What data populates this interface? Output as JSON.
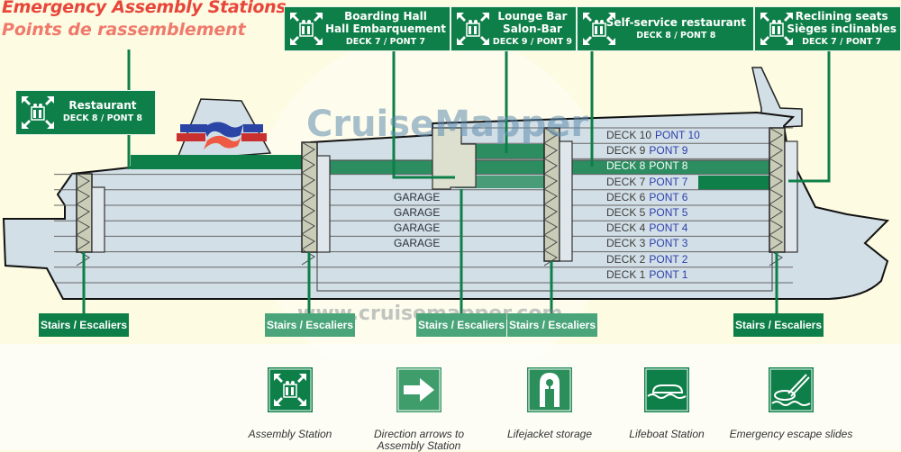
{
  "title": {
    "en": "Emergency Assembly Stations",
    "fr": "Points de rassemblement"
  },
  "colors": {
    "sign_green": "#0e7f48",
    "title_red": "#e8463a",
    "hull": "#d2dfe6",
    "background": "#fdfbe2"
  },
  "assembly_stations": [
    {
      "name": "Restaurant",
      "name_fr": "",
      "deck": "DECK 8 / PONT 8",
      "icon": "assembly-station-icon"
    },
    {
      "name": "Boarding Hall",
      "name_fr": "Hall Embarquement",
      "deck": "DECK 7 / PONT 7",
      "icon": "assembly-station-icon"
    },
    {
      "name": "Lounge Bar",
      "name_fr": "Salon-Bar",
      "deck": "DECK 9 / PONT 9",
      "icon": "assembly-station-icon"
    },
    {
      "name": "Self-service restaurant",
      "name_fr": "",
      "deck": "DECK 8 / PONT 8",
      "icon": "assembly-station-icon"
    },
    {
      "name": "Reclining seats",
      "name_fr": "Sièges inclinables",
      "deck": "DECK 7 / PONT 7",
      "icon": "assembly-station-icon"
    }
  ],
  "decks": [
    {
      "deck": "DECK 10",
      "pont": "PONT 10",
      "highlighted": false
    },
    {
      "deck": "DECK 9",
      "pont": "PONT 9",
      "highlighted": false
    },
    {
      "deck": "DECK 8",
      "pont": "PONT 8",
      "highlighted": true
    },
    {
      "deck": "DECK 7",
      "pont": "PONT 7",
      "highlighted": false
    },
    {
      "deck": "DECK 6",
      "pont": "PONT 6",
      "highlighted": false
    },
    {
      "deck": "DECK 5",
      "pont": "PONT 5",
      "highlighted": false
    },
    {
      "deck": "DECK 4",
      "pont": "PONT 4",
      "highlighted": false
    },
    {
      "deck": "DECK 3",
      "pont": "PONT 3",
      "highlighted": false
    },
    {
      "deck": "DECK 2",
      "pont": "PONT 2",
      "highlighted": false
    },
    {
      "deck": "DECK 1",
      "pont": "PONT 1",
      "highlighted": false
    }
  ],
  "garages": [
    "GARAGE",
    "GARAGE",
    "GARAGE",
    "GARAGE"
  ],
  "stairs": [
    {
      "label": "Stairs / Escaliers"
    },
    {
      "label": "Stairs / Escaliers"
    },
    {
      "label": "Stairs / Escaliers"
    },
    {
      "label": "Stairs / Escaliers"
    },
    {
      "label": "Stairs / Escaliers"
    }
  ],
  "legend": [
    {
      "label": "Assembly Station",
      "icon": "assembly-station-icon"
    },
    {
      "label": "Direction arrows to Assembly Station",
      "icon": "direction-arrow-icon"
    },
    {
      "label": "Lifejacket storage",
      "icon": "lifejacket-icon"
    },
    {
      "label": "Lifeboat Station",
      "icon": "lifeboat-icon"
    },
    {
      "label": "Emergency escape slides",
      "icon": "escape-slide-icon"
    }
  ],
  "watermark": {
    "brand": "CruiseMapper",
    "url": "www.cruisemapper.com"
  }
}
